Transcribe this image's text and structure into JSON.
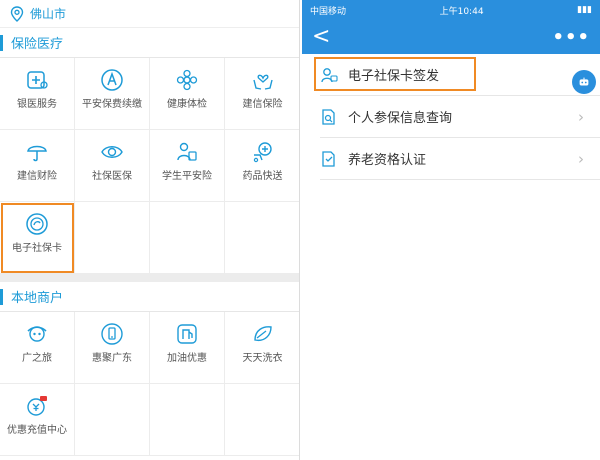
{
  "location": {
    "city": "佛山市"
  },
  "sections": {
    "insurance": {
      "title": "保险医疗",
      "items": [
        "银医服务",
        "平安保费续缴",
        "健康体检",
        "建信保险",
        "建信财险",
        "社保医保",
        "学生平安险",
        "药品快送",
        "电子社保卡"
      ]
    },
    "merchants": {
      "title": "本地商户",
      "items": [
        "广之旅",
        "惠聚广东",
        "加油优惠",
        "天天洗衣",
        "优惠充值中心"
      ]
    }
  },
  "phone": {
    "carrier": "中国移动",
    "time": "上午10:44",
    "back": "<",
    "more": "•••"
  },
  "menu": [
    "电子社保卡签发",
    "个人参保信息查询",
    "养老资格认证"
  ],
  "colors": {
    "accent": "#1e9bd7",
    "nav": "#2a8fdd",
    "highlight": "#f08a24"
  },
  "icons": [
    "location-pin-icon",
    "medical-cross-icon",
    "letter-a-icon",
    "flower-icon",
    "heart-hands-icon",
    "umbrella-icon",
    "eye-icon",
    "student-icon",
    "medicine-delivery-icon",
    "social-card-icon",
    "tourist-icon",
    "phone-icon",
    "fuel-icon",
    "leaf-icon",
    "coupon-icon",
    "person-card-icon",
    "document-search-icon",
    "document-check-icon",
    "chevron-right-icon"
  ]
}
